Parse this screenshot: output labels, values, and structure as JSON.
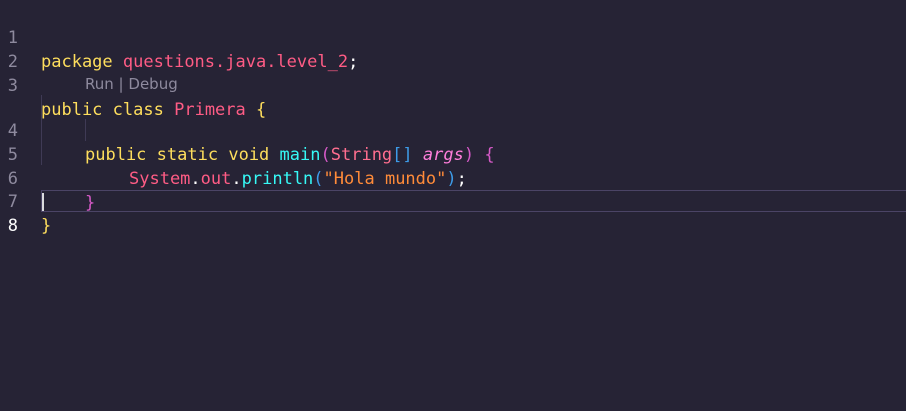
{
  "editor": {
    "language": "java",
    "theme_background": "#262335",
    "current_line": 8,
    "lines": [
      {
        "number": "1"
      },
      {
        "number": "2"
      },
      {
        "number": "3"
      },
      {
        "number": "4"
      },
      {
        "number": "5"
      },
      {
        "number": "6"
      },
      {
        "number": "7"
      },
      {
        "number": "8"
      }
    ],
    "codelens": {
      "run_label": "Run",
      "separator": "|",
      "debug_label": "Debug"
    },
    "code": {
      "l1": {
        "kw_package": "package",
        "pkg_name": "questions.java.level_2",
        "semicolon": ";"
      },
      "l3": {
        "kw_public": "public",
        "kw_class": "class",
        "class_name": "Primera",
        "brace_open": "{"
      },
      "l4": {
        "kw_public": "public",
        "kw_static": "static",
        "kw_void": "void",
        "method_name": "main",
        "paren_open": "(",
        "param_type": "String",
        "array_brackets": "[]",
        "param_name": "args",
        "paren_close": ")",
        "brace_open": "{"
      },
      "l5": {
        "obj_system": "System",
        "dot1": ".",
        "field_out": "out",
        "dot2": ".",
        "method_println": "println",
        "paren_open": "(",
        "string_literal": "\"Hola mundo\"",
        "paren_close": ")",
        "semicolon": ";"
      },
      "l6": {
        "brace_close": "}"
      },
      "l7": {
        "brace_close": "}"
      }
    }
  },
  "colors": {
    "keyword": "#fede5d",
    "identifier_pink": "#ff5c85",
    "function": "#36f9f6",
    "string": "#ff8b39",
    "parameter": "#ff7edb",
    "bracket_blue": "#3d9be8",
    "bracket_magenta": "#d65ac8",
    "line_number": "#8e8a9e"
  }
}
